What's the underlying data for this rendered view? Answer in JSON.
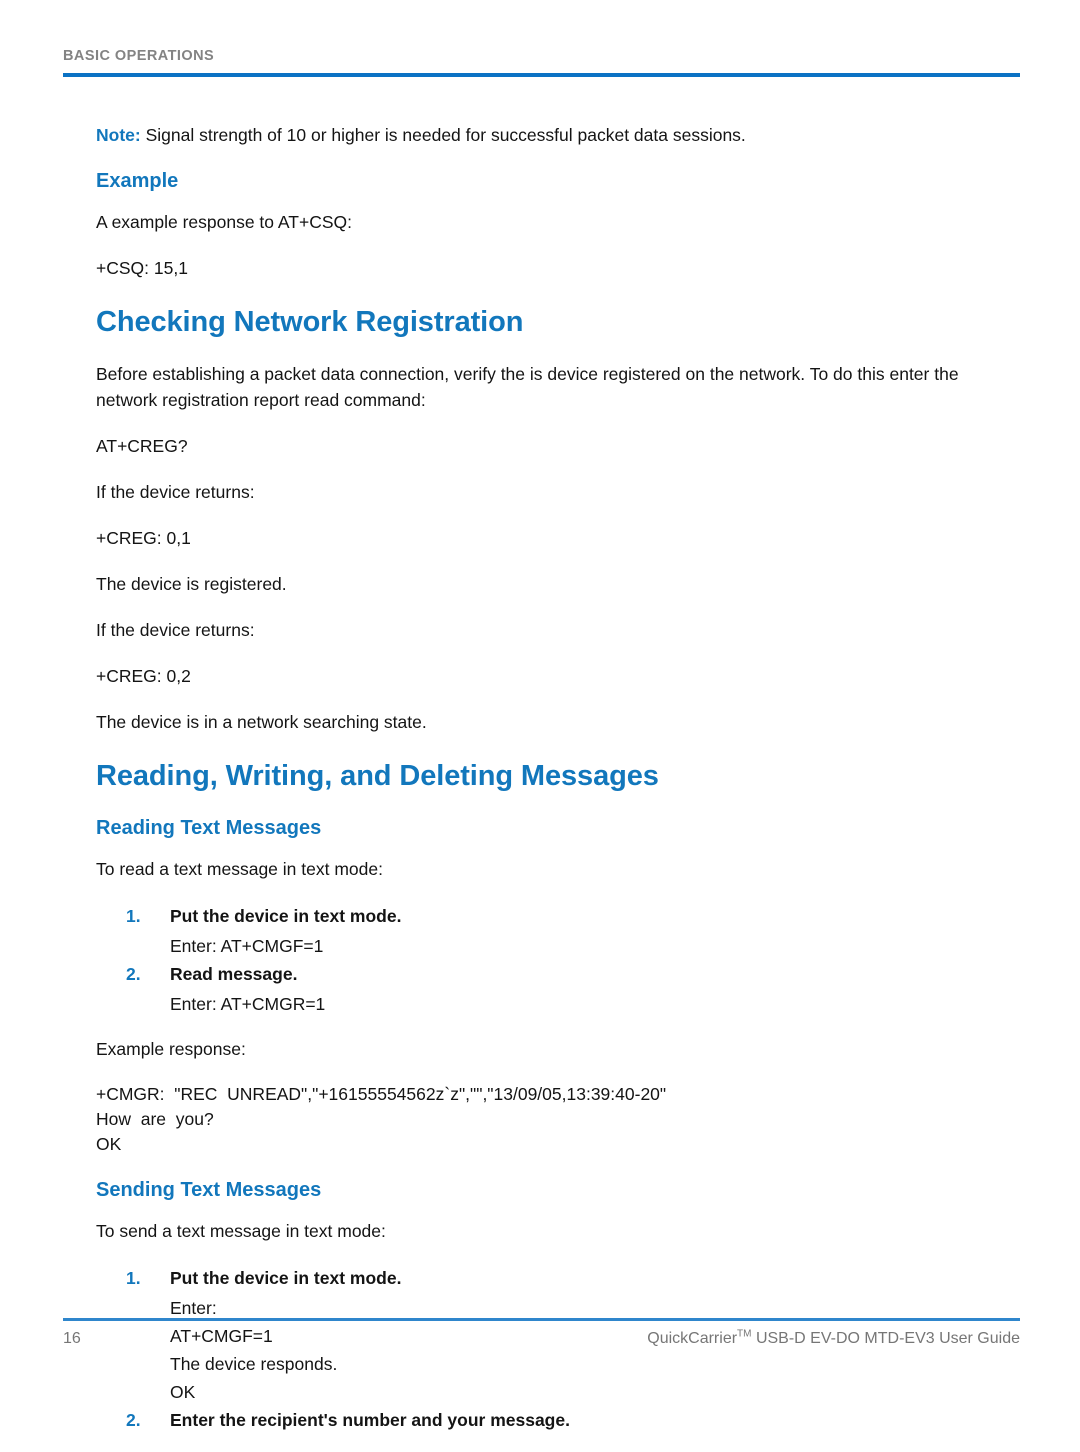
{
  "header": {
    "running_head": "BASIC OPERATIONS",
    "rule_color": "#0b72c4"
  },
  "colors": {
    "heading_blue": "#1277bc",
    "rule_blue": "#0b72c4",
    "footer_rule_blue": "#2f86cc",
    "running_head_gray": "#838383",
    "footer_gray": "#767676",
    "body_black": "#141414"
  },
  "note": {
    "label": "Note:",
    "text": " Signal strength of 10 or higher is needed for successful packet data sessions."
  },
  "example_section": {
    "heading": "Example",
    "intro": "A example response to AT+CSQ:",
    "response": "+CSQ:  15,1"
  },
  "checking_network_registration": {
    "heading": "Checking Network Registration",
    "intro": "Before establishing a packet data connection, verify the is device registered on the network. To do this enter the network registration report read command:",
    "command": "AT+CREG?",
    "returns_label_1": "If the device returns:",
    "response_1": "+CREG:  0,1",
    "result_1": "The device is registered.",
    "returns_label_2": "If the device returns:",
    "response_2": "+CREG:  0,2",
    "result_2": "The device is in a network searching state."
  },
  "messages_section": {
    "heading": "Reading, Writing, and Deleting Messages",
    "reading": {
      "heading": "Reading Text Messages",
      "intro": "To read a text message in text mode:",
      "steps": [
        {
          "num": "1.",
          "title": "Put the device in text mode.",
          "detail": "Enter: AT+CMGF=1"
        },
        {
          "num": "2.",
          "title": "Read message.",
          "detail": "Enter: AT+CMGR=1"
        }
      ],
      "example_label": "Example response:",
      "example_response": "+CMGR:  \"REC  UNREAD\",\"+16155554562z`z\",\"\",\"13/09/05,13:39:40-20\"\nHow  are  you?\nOK"
    },
    "sending": {
      "heading": "Sending Text Messages",
      "intro": "To send a text message in text mode:",
      "steps": [
        {
          "num": "1.",
          "title": "Put the device in text mode.",
          "detail_lines": [
            "Enter:",
            "AT+CMGF=1",
            "The device responds.",
            "OK"
          ]
        },
        {
          "num": "2.",
          "title": "Enter the recipient's number and your message.",
          "detail_lines": []
        }
      ]
    }
  },
  "footer": {
    "page_number": "16",
    "guide_title_main": "QuickCarrier",
    "guide_title_sup": "TM",
    "guide_title_rest": " USB-D EV-DO MTD-EV3 User Guide"
  }
}
